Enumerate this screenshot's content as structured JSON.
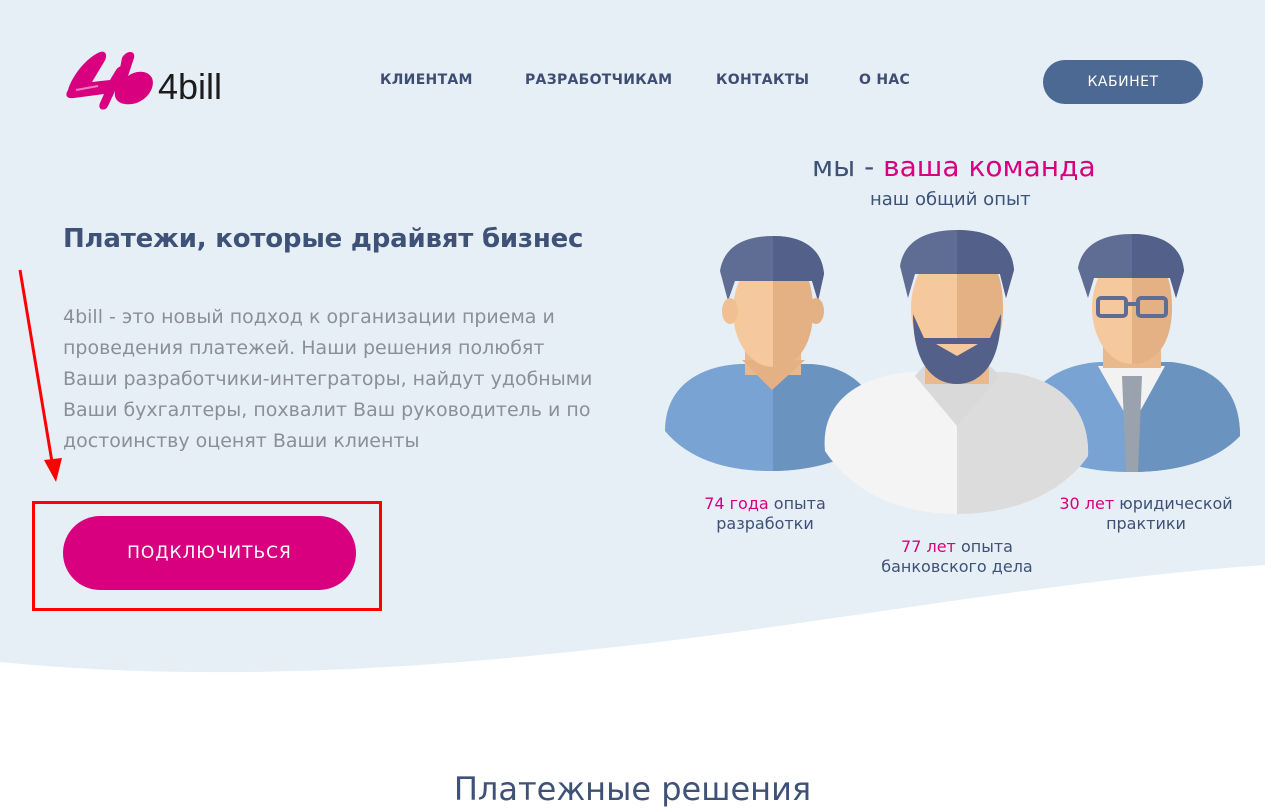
{
  "brand": {
    "logo_text": "4bill",
    "logo_mark": "4b"
  },
  "nav": {
    "items": [
      {
        "label": "КЛИЕНТАМ"
      },
      {
        "label": "РАЗРАБОТЧИКАМ"
      },
      {
        "label": "КОНТАКТЫ"
      },
      {
        "label": "О НАС"
      }
    ],
    "cabinet_label": "КАБИНЕТ"
  },
  "hero": {
    "title": "Платежи, которые драйвят бизнес",
    "description": "4bill - это новый подход к организации приема и проведения платежей. Наши решения полюбят Ваши разработчики-интеграторы, найдут удобными Ваши бухгалтеры, похвалит Ваш руководитель и по достоинству оценят Ваши клиенты",
    "connect_label": "ПОДКЛЮЧИТЬСЯ"
  },
  "team": {
    "title_prefix": "мы - ",
    "title_accent": "ваша команда",
    "subtitle": "наш общий опыт",
    "stats": [
      {
        "num": "74 года",
        "line1_rest": " опыта",
        "line2": "разработки"
      },
      {
        "num": "77 лет",
        "line1_rest": " опыта",
        "line2": "банковского дела"
      },
      {
        "num": "30 лет",
        "line1_rest": " юридической",
        "line2": "практики"
      }
    ]
  },
  "next_section": {
    "title": "Платежные решения"
  },
  "colors": {
    "brand_pink": "#d8007f",
    "navy": "#3e5176",
    "cabinet_blue": "#4b6992",
    "hero_bg": "#e6eef6",
    "annotation_red": "#ff0000"
  }
}
